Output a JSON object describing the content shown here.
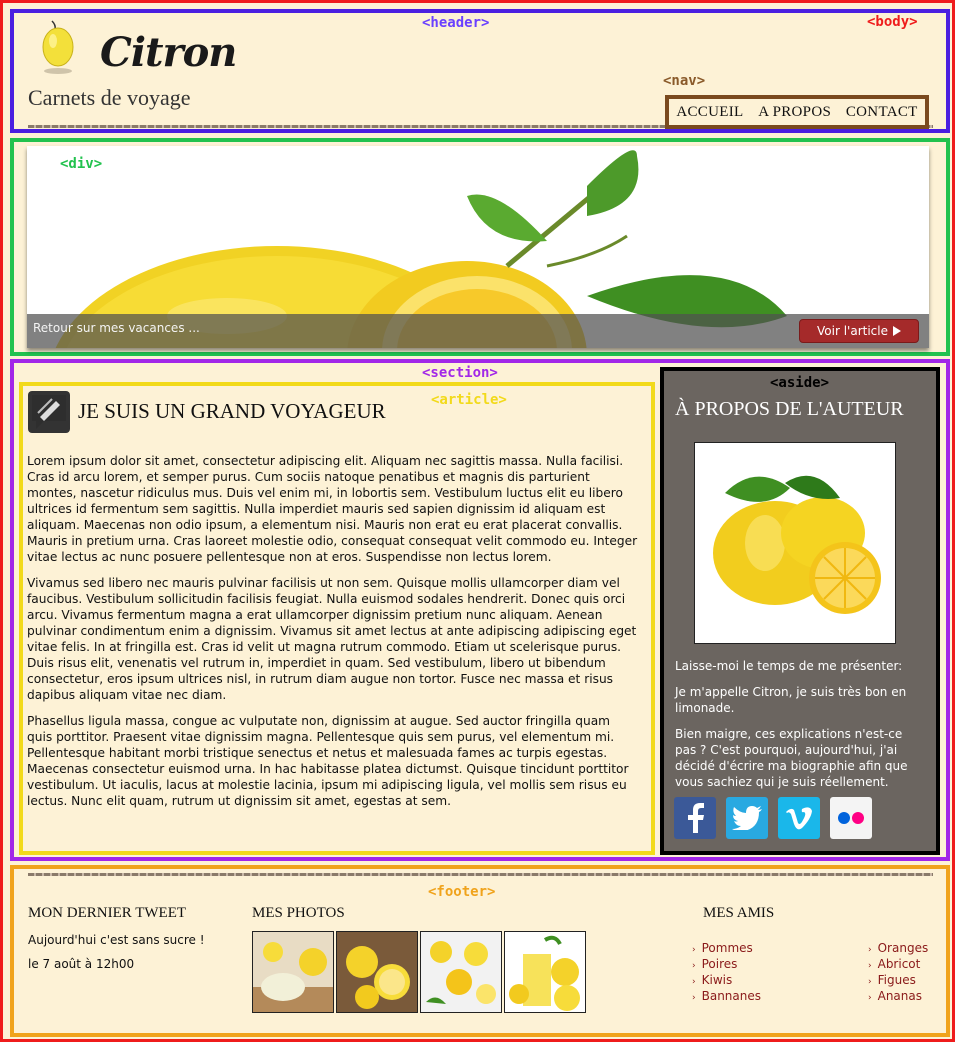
{
  "annotations": {
    "header": "<header>",
    "body": "<body>",
    "nav": "<nav>",
    "div": "<div>",
    "section": "<section>",
    "article": "<article>",
    "aside": "<aside>",
    "footer": "<footer>"
  },
  "annotation_colors": {
    "body": "#ef1c1c",
    "header": "#4a1fe0",
    "nav": "#7a4a1e",
    "div": "#22c24e",
    "section": "#a227e8",
    "article": "#f2da1a",
    "aside": "#000000",
    "footer": "#f0a31c"
  },
  "header": {
    "brand": "Citron",
    "subtitle": "Carnets de voyage",
    "logo_icon": "lemon-icon"
  },
  "nav": {
    "items": [
      "ACCUEIL",
      "A PROPOS",
      "CONTACT"
    ]
  },
  "banner": {
    "caption": "Retour sur mes vacances ...",
    "button_label": "Voir l'article",
    "button_icon": "play-triangle-icon",
    "button_color": "#a52a2a"
  },
  "article": {
    "title": "JE SUIS UN GRAND VOYAGEUR",
    "icon": "pen-bubble-icon",
    "paragraphs": [
      "Lorem ipsum dolor sit amet, consectetur adipiscing elit. Aliquam nec sagittis massa. Nulla facilisi. Cras id arcu lorem, et semper purus. Cum sociis natoque penatibus et magnis dis parturient montes, nascetur ridiculus mus. Duis vel enim mi, in lobortis sem. Vestibulum luctus elit eu libero ultrices id fermentum sem sagittis. Nulla imperdiet mauris sed sapien dignissim id aliquam est aliquam. Maecenas non odio ipsum, a elementum nisi. Mauris non erat eu erat placerat convallis. Mauris in pretium urna. Cras laoreet molestie odio, consequat consequat velit commodo eu. Integer vitae lectus ac nunc posuere pellentesque non at eros. Suspendisse non lectus lorem.",
      "Vivamus sed libero nec mauris pulvinar facilisis ut non sem. Quisque mollis ullamcorper diam vel faucibus. Vestibulum sollicitudin facilisis feugiat. Nulla euismod sodales hendrerit. Donec quis orci arcu. Vivamus fermentum magna a erat ullamcorper dignissim pretium nunc aliquam. Aenean pulvinar condimentum enim a dignissim. Vivamus sit amet lectus at ante adipiscing adipiscing eget vitae felis. In at fringilla est. Cras id velit ut magna rutrum commodo. Etiam ut scelerisque purus. Duis risus elit, venenatis vel rutrum in, imperdiet in quam. Sed vestibulum, libero ut bibendum consectetur, eros ipsum ultrices nisl, in rutrum diam augue non tortor. Fusce nec massa et risus dapibus aliquam vitae nec diam.",
      "Phasellus ligula massa, congue ac vulputate non, dignissim at augue. Sed auctor fringilla quam quis porttitor. Praesent vitae dignissim magna. Pellentesque quis sem purus, vel elementum mi. Pellentesque habitant morbi tristique senectus et netus et malesuada fames ac turpis egestas. Maecenas consectetur euismod urna. In hac habitasse platea dictumst. Quisque tincidunt porttitor vestibulum. Ut iaculis, lacus at molestie lacinia, ipsum mi adipiscing ligula, vel mollis sem risus eu lectus. Nunc elit quam, rutrum ut dignissim sit amet, egestas at sem."
    ]
  },
  "aside": {
    "title": "À PROPOS DE L'AUTEUR",
    "paragraphs": [
      "Laisse-moi le temps de me présenter:",
      "Je m'appelle Citron, je suis très bon en limonade.",
      "Bien maigre, ces explications n'est-ce pas ? C'est pourquoi, aujourd'hui, j'ai décidé d'écrire ma biographie afin que vous sachiez qui je suis réellement."
    ],
    "socials": [
      "facebook-icon",
      "twitter-icon",
      "vimeo-icon",
      "flickr-icon"
    ],
    "background": "#6b6560"
  },
  "footer": {
    "tweet_heading": "MON DERNIER TWEET",
    "tweet_text": "Aujourd'hui c'est sans sucre !",
    "tweet_date": "le 7 août à 12h00",
    "photos_heading": "MES PHOTOS",
    "friends_heading": "MES AMIS",
    "friends_col1": [
      "Pommes",
      "Poires",
      "Kiwis",
      "Bannanes"
    ],
    "friends_col2": [
      "Oranges",
      "Abricot",
      "Figues",
      "Ananas"
    ],
    "link_color": "#8a1a1a"
  }
}
